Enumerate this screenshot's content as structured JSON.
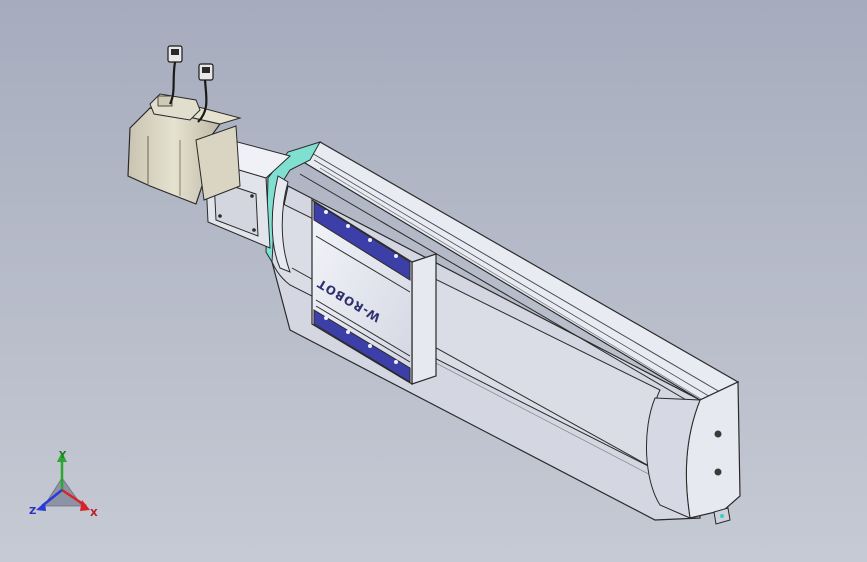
{
  "viewport": {
    "background_top": "#a6acbd",
    "background_bottom": "#c6cad4"
  },
  "model": {
    "name": "linear-actuator-module",
    "carriage_brand_text": "W-ROBOT",
    "colors": {
      "body": "#e4e6ee",
      "body_shadow": "#c9ccd8",
      "edge": "#2a2a2a",
      "carriage_accent": "#3d3fa8",
      "coupling": "#7fe0d2",
      "motor": "#d9d5c2",
      "cable": "#1a1a1a"
    }
  },
  "triad": {
    "x_label": "X",
    "y_label": "Y",
    "z_label": "Z",
    "x_color": "#d8232a",
    "y_color": "#2aa832",
    "z_color": "#2a3ad8"
  }
}
